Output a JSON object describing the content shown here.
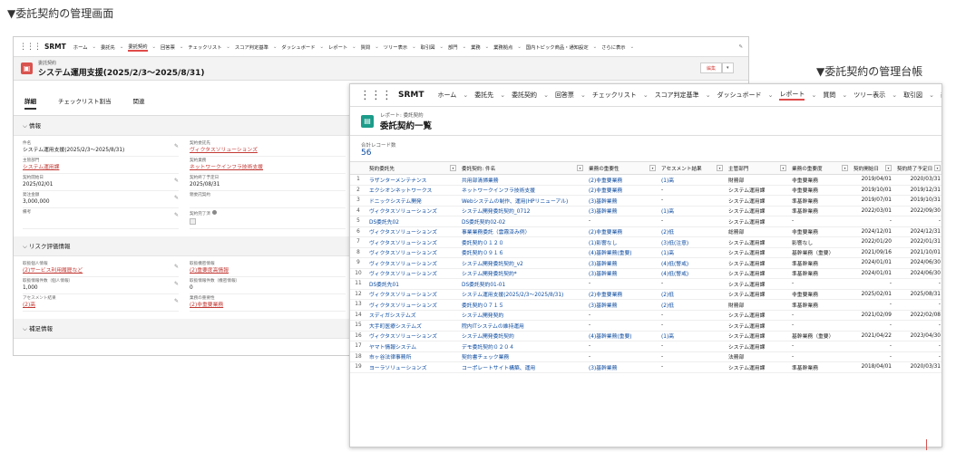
{
  "captions": {
    "left": "▼委託契約の管理画面",
    "right": "▼委託契約の管理台帳"
  },
  "left_window": {
    "nav": {
      "app": "SRMT",
      "items": [
        "ホーム",
        "委託先",
        "委託契約",
        "回答票",
        "チェックリスト",
        "スコア判定基準",
        "ダッシュボード",
        "レポート",
        "質問",
        "ツリー表示",
        "取引図",
        "部門",
        "業務",
        "業務拠点",
        "国内トピック商品・通知設定",
        "さらに表示"
      ],
      "active": "委託契約"
    },
    "header": {
      "type": "委託契約",
      "title": "システム運用支援(2025/2/3〜2025/8/31)",
      "edit_label": "編集",
      "edit_menu": "▾"
    },
    "tabs": [
      "詳細",
      "チェックリスト割当",
      "関連"
    ],
    "sections": {
      "info": "情報",
      "risk": "リスク評価情報",
      "supplement": "補足情報"
    },
    "info_fields": [
      {
        "label": "件名",
        "value": "システム運用支援(2025/2/3〜2025/8/31)",
        "link": false,
        "edit": true
      },
      {
        "label": "契約委託先",
        "value": "ヴィクタスソリューションズ",
        "link": true,
        "edit": false
      },
      {
        "label": "主管部門",
        "value": "システム運用課",
        "link": true,
        "edit": false
      },
      {
        "label": "契約業務",
        "value": "ネットワークインフラ技術支援",
        "link": true,
        "edit": false
      },
      {
        "label": "契約開始日",
        "value": "2025/02/01",
        "link": false,
        "edit": true
      },
      {
        "label": "契約終了予定日",
        "value": "2025/08/31",
        "link": false,
        "edit": false
      },
      {
        "label": "発注金額",
        "value": "3,000,000",
        "link": false,
        "edit": true
      },
      {
        "label": "親委託契約",
        "value": "",
        "link": false,
        "edit": false
      },
      {
        "label": "備考",
        "value": "",
        "link": false,
        "edit": true
      },
      {
        "label": "契約完了済",
        "value": "",
        "link": false,
        "edit": false,
        "checkbox": true,
        "info": true
      }
    ],
    "risk_fields": [
      {
        "label": "取扱個人情報",
        "value": "(2)サービス利用履歴など",
        "link": true,
        "edit": true
      },
      {
        "label": "取扱機密情報",
        "value": "(2)重要度高情報",
        "link": true,
        "edit": false
      },
      {
        "label": "取扱情報件数（個人情報）",
        "value": "1,000",
        "link": false,
        "edit": true
      },
      {
        "label": "取扱情報件数（機密情報）",
        "value": "0",
        "link": false,
        "edit": false
      },
      {
        "label": "アセスメント結果",
        "value": "(2)高",
        "link": true,
        "edit": true
      },
      {
        "label": "業務の重要性",
        "value": "(2)非重要業務",
        "link": true,
        "edit": false
      }
    ]
  },
  "right_window": {
    "nav": {
      "app": "SRMT",
      "items": [
        "ホーム",
        "委託先",
        "委託契約",
        "回答票",
        "チェックリスト",
        "スコア判定基準",
        "ダッシュボード",
        "レポート",
        "質問",
        "ツリー表示",
        "取引図",
        "部門"
      ],
      "active": "レポート"
    },
    "header": {
      "sub": "レポート: 委託契約",
      "title": "委託契約一覧"
    },
    "count": {
      "label": "合計レコード数",
      "value": "56"
    },
    "columns": [
      "",
      "契約委託先",
      "委託契約: 件名",
      "業務の重要性",
      "アセスメント結果",
      "主管部門",
      "業務の重要度",
      "契約開始日",
      "契約終了予定日"
    ],
    "rows": [
      [
        "1",
        "ラザンターメンテナンス",
        "共用部清掃業務",
        "(2)非重要業務",
        "(1)高",
        "財務部",
        "非重要業務",
        "2019/04/01",
        "2020/03/31"
      ],
      [
        "2",
        "エクシオンネットワークス",
        "ネットワークインフラ技術支援",
        "(2)非重要業務",
        "-",
        "システム運用課",
        "非重要業務",
        "2019/10/01",
        "2019/12/31"
      ],
      [
        "3",
        "ドニックシステム開発",
        "Webシステムの制作、運用(HPリニューアル)",
        "(3)基幹業務",
        "-",
        "システム運用課",
        "準基幹業務",
        "2019/07/01",
        "2019/10/31"
      ],
      [
        "4",
        "ヴィクタスソリューションズ",
        "システム開発委託契約_0712",
        "(3)基幹業務",
        "(1)高",
        "システム運用課",
        "準基幹業務",
        "2022/03/01",
        "2022/09/30"
      ],
      [
        "5",
        "DS委託先02",
        "DS委託契約02-02",
        "-",
        "-",
        "システム運用課",
        "-",
        "-",
        "-"
      ],
      [
        "6",
        "ヴィクタスソリューションズ",
        "事業業務委託（雲霧済み例）",
        "(2)非重要業務",
        "(2)低",
        "総務部",
        "非重要業務",
        "2024/12/01",
        "2024/12/31"
      ],
      [
        "7",
        "ヴィクタスソリューションズ",
        "委託契約０１２０",
        "(1)影響なし",
        "(3)低(注意)",
        "システム運用課",
        "影響なし",
        "2022/01/20",
        "2022/01/31"
      ],
      [
        "8",
        "ヴィクタスソリューションズ",
        "委託契約０９１６",
        "(4)基幹業務(重要)",
        "(1)高",
        "システム運用課",
        "基幹業務（重要）",
        "2021/09/16",
        "2021/10/01"
      ],
      [
        "9",
        "ヴィクタスソリューションズ",
        "システム開発委託契約_v2",
        "(3)基幹業務",
        "(4)低(警戒)",
        "システム運用課",
        "準基幹業務",
        "2024/01/01",
        "2024/06/30"
      ],
      [
        "10",
        "ヴィクタスソリューションズ",
        "システム開発委託契約*",
        "(3)基幹業務",
        "(4)低(警戒)",
        "システム運用課",
        "準基幹業務",
        "2024/01/01",
        "2024/06/30"
      ],
      [
        "11",
        "DS委託先01",
        "DS委託契約01-01",
        "-",
        "-",
        "システム運用課",
        "-",
        "-",
        "-"
      ],
      [
        "12",
        "ヴィクタスソリューションズ",
        "システム運用支援(2025/2/3〜2025/8/31)",
        "(2)非重要業務",
        "(2)低",
        "システム運用課",
        "非重要業務",
        "2025/02/01",
        "2025/08/31"
      ],
      [
        "13",
        "ヴィクタスソリューションズ",
        "委託契約０７１５",
        "(3)基幹業務",
        "(2)低",
        "財務部",
        "準基幹業務",
        "-",
        "-"
      ],
      [
        "14",
        "スディガシステムズ",
        "システム開発契約",
        "-",
        "-",
        "システム運用課",
        "-",
        "2021/02/09",
        "2022/02/08"
      ],
      [
        "15",
        "大手町医療システムズ",
        "院内ITシステムの維持運用",
        "-",
        "-",
        "システム運用課",
        "-",
        "-",
        "-"
      ],
      [
        "16",
        "ヴィクタスソリューションズ",
        "システム開発委託契約",
        "(4)基幹業務(重要)",
        "(1)高",
        "システム運用課",
        "基幹業務（重要）",
        "2021/04/22",
        "2023/04/30"
      ],
      [
        "17",
        "ヤマト情報システム",
        "デモ委託契約０２０４",
        "-",
        "-",
        "システム運用課",
        "-",
        "-",
        "-"
      ],
      [
        "18",
        "市ヶ谷法律事務所",
        "契約書チェック業務",
        "-",
        "-",
        "法務部",
        "-",
        "-",
        "-"
      ],
      [
        "19",
        "ヨーラソリューションズ",
        "コーポレートサイト構築、運用",
        "(3)基幹業務",
        "-",
        "システム運用課",
        "準基幹業務",
        "2018/04/01",
        "2020/03/31"
      ]
    ]
  }
}
